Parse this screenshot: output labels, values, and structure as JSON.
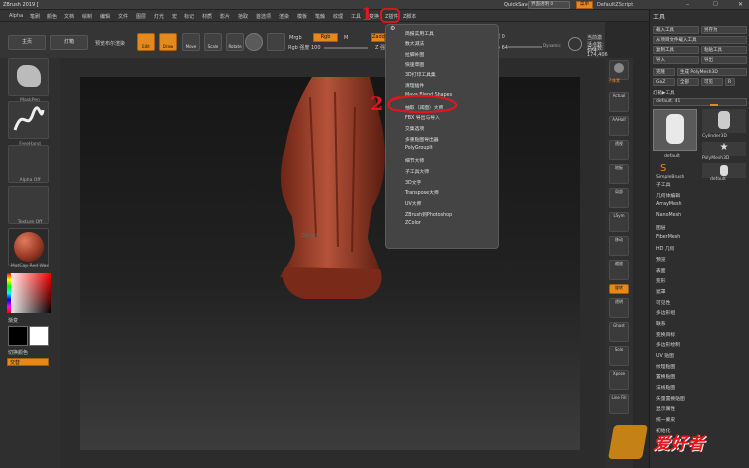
{
  "window": {
    "title": "ZBrush 2019 ["
  },
  "titlebar": {
    "quicksave": "QuickSave",
    "seethrough_label": "界面透明 0",
    "menus_label": "菜单",
    "script_label": "DefaultZScript"
  },
  "menubar": {
    "items": [
      "Alpha",
      "笔刷",
      "颜色",
      "文档",
      "绘制",
      "编辑",
      "文件",
      "图层",
      "灯光",
      "宏",
      "标记",
      "材质",
      "影片",
      "拾取",
      "首选项",
      "渲染",
      "模板",
      "笔触",
      "纹理",
      "工具",
      "变换",
      "Z插件",
      "Z脚本"
    ]
  },
  "toolbar": {
    "home": "主页",
    "lightbox": "灯箱",
    "preview_brush": "预览布尔渲染",
    "edit": "Edit",
    "draw": "Draw",
    "move": "Move",
    "scale": "Scale",
    "rotate": "Rotate",
    "mrgb": "Mrgb",
    "rgb": "Rgb",
    "m": "M",
    "zadd": "Zadd",
    "zsub": "Zsub",
    "rgb_intensity": "Rgb 强度 100",
    "z_intensity": "Z 强度 25",
    "focal_shift": "焦点衰减 0",
    "draw_size": "绘制大小 64",
    "dynamic": "Dynamic",
    "active_points": "当前激活点数: 174",
    "total_points": "总点数: 174,406"
  },
  "leftshelf": {
    "mask": "MaskPen",
    "freehand": "FreeHand",
    "alpha": "Alpha Off",
    "texture": "Texture Off",
    "material": "MatCap Red Wax",
    "gradient": "渐变",
    "switch_color": "切换颜色",
    "alternate": "交替"
  },
  "canvas": {
    "brand": "ZBrush"
  },
  "zplugin_menu": {
    "items": [
      "简报实用工具",
      "数大减法",
      "拉脚补图",
      "快速草图",
      "3D打印工具集",
      "清理插件",
      "Maya Blend Shapes",
      "抽取（减面）大师",
      "FBX 导出与导入",
      "交集选项",
      "多重贴图导出器",
      "PolyGroupIt",
      "细节大师",
      "子工具大师",
      "3D文字",
      "Transpose大师",
      "UV大师",
      "ZBrush到Photoshop",
      "ZColor"
    ]
  },
  "annotations": {
    "one": "1",
    "two": "2"
  },
  "rightshelf": {
    "items": [
      "子像素",
      "Actual",
      "AAHalf",
      "透视",
      "地板",
      "局部",
      "LSym",
      "移动",
      "缩放",
      "旋转",
      "透明",
      "Ghost",
      "Solo",
      "Xpose",
      "Line Fill"
    ]
  },
  "toolpanel": {
    "title": "工具",
    "btn_load": "载入工具",
    "btn_saveas": "另存为",
    "btn_import_project": "从项目文件载入工具",
    "btn_copy": "复制工具",
    "btn_paste": "粘贴工具",
    "btn_import": "导入",
    "btn_export": "导出",
    "btn_clone": "克隆",
    "btn_make_polymesh": "生成 PolyMesh3D",
    "btn_goz": "GoZ",
    "btn_all": "全部",
    "btn_visible": "可见",
    "btn_r": "R",
    "lightbox_tools": "灯箱▶工具",
    "current_tool": "default. 41",
    "thumbs": [
      "default",
      "Cylinder3D",
      "PolyMesh3D",
      "SimpleBrush",
      "default"
    ],
    "sections": [
      "子工具",
      "几何体编辑",
      "ArrayMesh",
      "NanoMesh",
      "图层",
      "FiberMesh",
      "HD 几何",
      "预览",
      "表面",
      "变形",
      "遮罩",
      "可见性",
      "多边形组",
      "联系",
      "变换目标",
      "多边形绘制",
      "UV 贴图",
      "纹理贴图",
      "置换贴图",
      "法线贴图",
      "矢量置换贴图",
      "显示属性",
      "统一蒙皮",
      "初始化"
    ]
  },
  "watermark": {
    "text": "爱好者"
  },
  "colors": {
    "accent": "#e6891d",
    "annotation": "#e8141c",
    "statue": "#9a3a26"
  }
}
